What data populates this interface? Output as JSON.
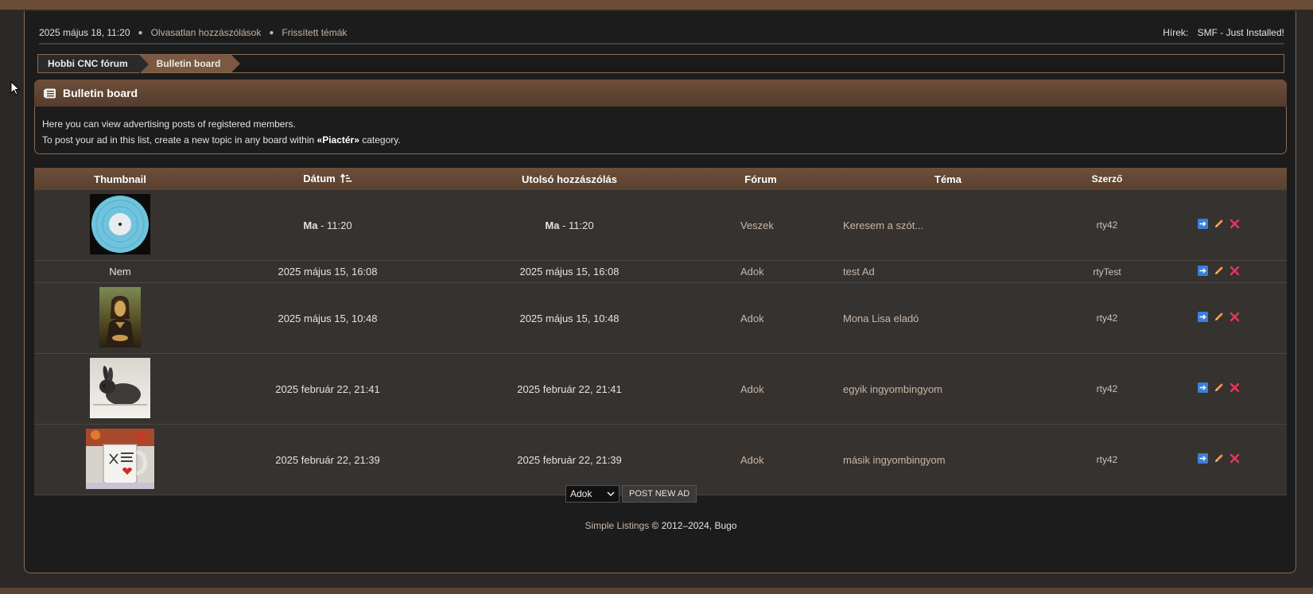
{
  "userbar": {
    "datetime": "2025 május 18, 11:20",
    "unread_posts": "Olvasatlan hozzászólások",
    "updated_topics": "Frissített témák",
    "news_label": "Hírek:",
    "news_text": "SMF - Just Installed!"
  },
  "breadcrumb": {
    "items": [
      "Hobbi CNC fórum",
      "Bulletin board"
    ]
  },
  "board": {
    "title": "Bulletin board",
    "title_icon": "list-board-icon",
    "desc_line1": "Here you can view advertising posts of registered members.",
    "desc_line2_pre": "To post your ad in this list, create a new topic in any board within ",
    "desc_line2_cat": "«Piactér»",
    "desc_line2_post": " category."
  },
  "table": {
    "headers": [
      "Thumbnail",
      "Dátum",
      "Utolsó hozzászólás",
      "Fórum",
      "Téma",
      "Szerző"
    ],
    "sort_icon": "sort-ascending-icon",
    "rows": [
      {
        "thumbnail": "vinyl-record-image",
        "thumb_text": "",
        "date_bold": "Ma",
        "date_rest": " - 11:20",
        "last_bold": "Ma",
        "last_rest": " - 11:20",
        "forum": "Veszek",
        "topic": "Keresem a szót...",
        "author": "rty42"
      },
      {
        "thumbnail": "",
        "thumb_text": "Nem",
        "date_bold": "",
        "date_rest": "2025 május 15, 16:08",
        "last_bold": "",
        "last_rest": "2025 május 15, 16:08",
        "forum": "Adok",
        "topic": "test Ad",
        "author": "rtyTest"
      },
      {
        "thumbnail": "mona-lisa-image",
        "thumb_text": "",
        "date_bold": "",
        "date_rest": "2025 május 15, 10:48",
        "last_bold": "",
        "last_rest": "2025 május 15, 10:48",
        "forum": "Adok",
        "topic": "Mona Lisa eladó",
        "author": "rty42"
      },
      {
        "thumbnail": "rabbit-image",
        "thumb_text": "",
        "date_bold": "",
        "date_rest": "2025 február 22, 21:41",
        "last_bold": "",
        "last_rest": "2025 február 22, 21:41",
        "forum": "Adok",
        "topic": "egyik ingyombingyom",
        "author": "rty42"
      },
      {
        "thumbnail": "mug-image",
        "thumb_text": "",
        "date_bold": "",
        "date_rest": "2025 február 22, 21:39",
        "last_bold": "",
        "last_rest": "2025 február 22, 21:39",
        "forum": "Adok",
        "topic": "másik ingyombingyom",
        "author": "rty42"
      }
    ],
    "action_icons": [
      "move-icon",
      "edit-pencil-icon",
      "delete-x-icon"
    ]
  },
  "bottom": {
    "select_value": "Adok",
    "post_button": "POST NEW AD"
  },
  "footer": {
    "link": "Simple Listings",
    "rest": " © 2012–2024, Bugo"
  },
  "colors": {
    "accent": "#6d4e3a",
    "background": "#1c1c1c",
    "row_bg": "#353230",
    "delete": "#e8365d"
  }
}
